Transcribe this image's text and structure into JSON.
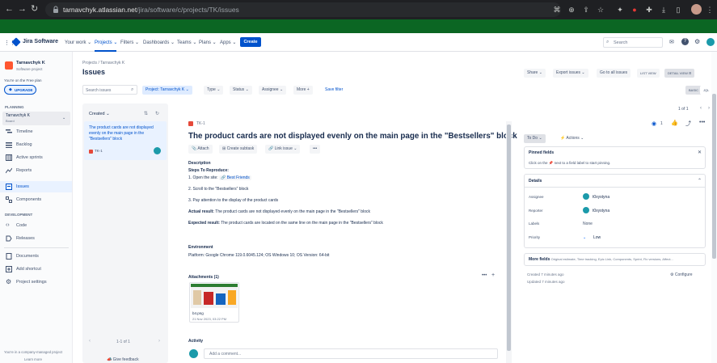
{
  "browser": {
    "url_domain": "tarnavchyk.atlassian.net",
    "url_path": "/jira/software/c/projects/TK/issues"
  },
  "topnav": {
    "logo": "Jira Software",
    "items": [
      "Your work",
      "Projects",
      "Filters",
      "Dashboards",
      "Teams",
      "Plans",
      "Apps"
    ],
    "create": "Create",
    "search_placeholder": "Search"
  },
  "sidebar": {
    "project_name": "Tarnavchyk K",
    "project_type": "Software project",
    "plan_note": "You're on the Free plan",
    "upgrade": "UPGRADE",
    "planning_header": "PLANNING",
    "board_name": "Tarnavchyk K",
    "board_sub": "Board",
    "planning_items": [
      "Timeline",
      "Backlog",
      "Active sprints",
      "Reports"
    ],
    "issues": "Issues",
    "components": "Components",
    "development_header": "DEVELOPMENT",
    "dev_items": [
      "Code",
      "Releases"
    ],
    "other_items": [
      "Documents",
      "Add shortcut",
      "Project settings"
    ],
    "footer_note": "You're in a company-managed project",
    "learn_more": "Learn more"
  },
  "header": {
    "breadcrumb_projects": "Projects",
    "breadcrumb_sep": "/",
    "breadcrumb_project": "Tarnavchyk K",
    "title": "Issues",
    "share": "Share",
    "export": "Export issues",
    "goto_all": "Go to all issues",
    "list_view": "LIST VIEW",
    "detail_view": "DETAIL VIEW",
    "basic": "BASIC",
    "jql": "JQL"
  },
  "filters": {
    "search_placeholder": "Search issues",
    "project": "Project: Tarnavchyk K",
    "type": "Type",
    "status": "Status",
    "assignee": "Assignee",
    "more": "More",
    "more_plus": "+",
    "save": "Save filter"
  },
  "list": {
    "sort": "Created",
    "card_title": "The product cards are not displayed evenly on the main page in the \"Bestsellers\" block",
    "card_key": "TK-1",
    "pagination": "1-1 of 1",
    "feedback": "Give feedback",
    "paging_top": "1 of 1"
  },
  "issue": {
    "key": "TK-1",
    "title": "The product cards are not displayed evenly on the main page in the \"Bestsellers\" block",
    "actions": [
      "Attach",
      "Create subtask",
      "Link issue"
    ],
    "description_label": "Description",
    "steps_header": "Steps To Reproduce:",
    "step1_prefix": "1. Open the site:",
    "step1_link": "Best Friends",
    "step2": "2. Scroll to the \"Bestsellers\" block",
    "step3": "3. Pay attention to the display of the product cards",
    "actual_label": "Actual result:",
    "actual_text": "The product cards are not displayed evenly on the main page in the \"Bestsellers\" block",
    "expected_label": "Expected result:",
    "expected_text": "The product cards are located on the same line on the main page in the \"Bestsellers\" block",
    "environment_label": "Environment",
    "environment_text": "Platform: Google Chrome 119.0.6045.124; OS Windows 10; OS Version: 64-bit",
    "attachments_label": "Attachments (1)",
    "attachment_name": "b4.png",
    "attachment_date": "21 Nov 2023, 03:22 PM",
    "activity_label": "Activity",
    "comment_placeholder": "Add a comment..."
  },
  "right": {
    "status": "To Do",
    "actions": "Actions",
    "watch_count": "1",
    "pinned_title": "Pinned fields",
    "pinned_text": "Click on the",
    "pinned_text2": "next to a field label to start pinning.",
    "details_title": "Details",
    "assignee_label": "Assignee",
    "assignee_value": "t0xystyna",
    "reporter_label": "Reporter",
    "reporter_value": "t0xystyna",
    "labels_label": "Labels",
    "labels_value": "None",
    "priority_label": "Priority",
    "priority_value": "Low",
    "more_fields": "More fields",
    "more_fields_list": "Original estimate, Time tracking, Epic Link, Components, Sprint, Fix versions, Affect...",
    "created": "Created 7 minutes ago",
    "updated": "Updated 7 minutes ago",
    "configure": "Configure"
  },
  "colors": {
    "accent": "#0052cc",
    "green_bar": "#0b6623",
    "bug_red": "#e5493a"
  }
}
